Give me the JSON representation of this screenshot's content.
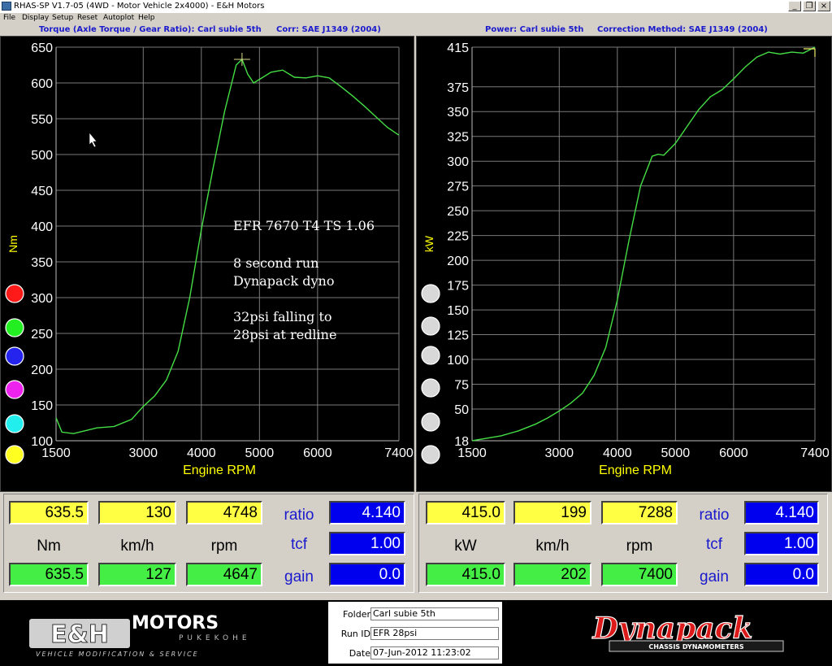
{
  "window": {
    "title": "RHAS-SP V1.7-05  (4WD - Motor Vehicle 2x4000) - E&H Motors",
    "buttons": [
      "_",
      "×"
    ]
  },
  "menu": [
    "File",
    "Display",
    "Setup",
    "Reset",
    "Autoplot",
    "Help"
  ],
  "torque_panel": {
    "title": "Torque (Axle Torque / Gear Ratio): Carl subie 5th",
    "corr": "Corr: SAE J1349 (2004)"
  },
  "power_panel": {
    "title": "Power: Carl subie 5th",
    "corr": "Correction Method: SAE J1349 (2004)"
  },
  "colors": {
    "curve": "#44dd44",
    "axis_text": "#ffffff",
    "axis_label": "#ffff00",
    "swatches_left": [
      "#ff1a1a",
      "#22ee22",
      "#2424ee",
      "#ee22ee",
      "#22eeee",
      "#ffff22"
    ],
    "swatch_right": "#d8d8d8"
  },
  "annotation": [
    "EFR 7670 T4 TS 1.06",
    "8 second run",
    "Dynapack dyno",
    "32psi falling to",
    "28psi at redline"
  ],
  "chart_data": [
    {
      "type": "line",
      "xlabel": "Engine RPM",
      "ylabel": "Nm",
      "x_ticks": [
        1500,
        3000,
        4000,
        5000,
        6000,
        7400
      ],
      "y_ticks": [
        100,
        150,
        200,
        250,
        300,
        350,
        400,
        450,
        500,
        550,
        600,
        650
      ],
      "xlim": [
        1500,
        7400
      ],
      "ylim": [
        100,
        650
      ],
      "grid": true,
      "series": [
        {
          "x": [
            1500,
            1600,
            1800,
            2000,
            2200,
            2500,
            2800,
            3000,
            3200,
            3400,
            3600,
            3800,
            4000,
            4200,
            4400,
            4600,
            4700,
            4800,
            4900,
            5000,
            5200,
            5400,
            5600,
            5800,
            6000,
            6200,
            6400,
            6600,
            6800,
            7000,
            7200,
            7400
          ],
          "y": [
            132,
            112,
            110,
            114,
            118,
            120,
            130,
            148,
            163,
            185,
            225,
            300,
            395,
            480,
            560,
            625,
            633,
            612,
            600,
            605,
            615,
            618,
            608,
            607,
            610,
            607,
            595,
            582,
            568,
            553,
            538,
            527
          ]
        }
      ]
    },
    {
      "type": "line",
      "xlabel": "Engine RPM",
      "ylabel": "kW",
      "x_ticks": [
        1500,
        3000,
        4000,
        5000,
        6000,
        7400
      ],
      "y_ticks": [
        18,
        50,
        75,
        100,
        125,
        150,
        175,
        200,
        225,
        250,
        275,
        300,
        325,
        350,
        375,
        415
      ],
      "xlim": [
        1500,
        7400
      ],
      "ylim": [
        18,
        415
      ],
      "grid": true,
      "series": [
        {
          "x": [
            1500,
            1700,
            2000,
            2300,
            2600,
            2800,
            3000,
            3200,
            3400,
            3600,
            3800,
            4000,
            4200,
            4400,
            4600,
            4700,
            4800,
            5000,
            5200,
            5400,
            5600,
            5800,
            6000,
            6200,
            6400,
            6600,
            6800,
            7000,
            7200,
            7400
          ],
          "y": [
            18,
            20,
            23,
            28,
            35,
            41,
            48,
            56,
            66,
            84,
            112,
            160,
            220,
            275,
            305,
            307,
            306,
            318,
            335,
            352,
            365,
            372,
            383,
            395,
            405,
            410,
            408,
            410,
            409,
            415
          ]
        }
      ]
    }
  ],
  "readout_left": {
    "top": [
      "635.5",
      "130",
      "4748"
    ],
    "units": [
      "Nm",
      "km/h",
      "rpm"
    ],
    "bottom": [
      "635.5",
      "127",
      "4647"
    ],
    "labels": [
      "ratio",
      "tcf",
      "gain"
    ],
    "values": [
      "4.140",
      "1.00",
      "0.0"
    ]
  },
  "readout_right": {
    "top": [
      "415.0",
      "199",
      "7288"
    ],
    "units": [
      "kW",
      "km/h",
      "rpm"
    ],
    "bottom": [
      "415.0",
      "202",
      "7400"
    ],
    "labels": [
      "ratio",
      "tcf",
      "gain"
    ],
    "values": [
      "4.140",
      "1.00",
      "0.0"
    ]
  },
  "footer": {
    "logo_left": "E&H MOTORS",
    "logo_left_sub": "PUKEKOHE",
    "logo_left_tag": "VEHICLE MODIFICATION & SERVICE",
    "logo_right": "Dynapack",
    "logo_right_sub": "CHASSIS DYNAMOMETERS",
    "fields": [
      {
        "label": "Folder",
        "value": "Carl subie 5th"
      },
      {
        "label": "Run ID",
        "value": "EFR 28psi"
      },
      {
        "label": "Date",
        "value": "07-Jun-2012  11:23:02"
      }
    ]
  }
}
